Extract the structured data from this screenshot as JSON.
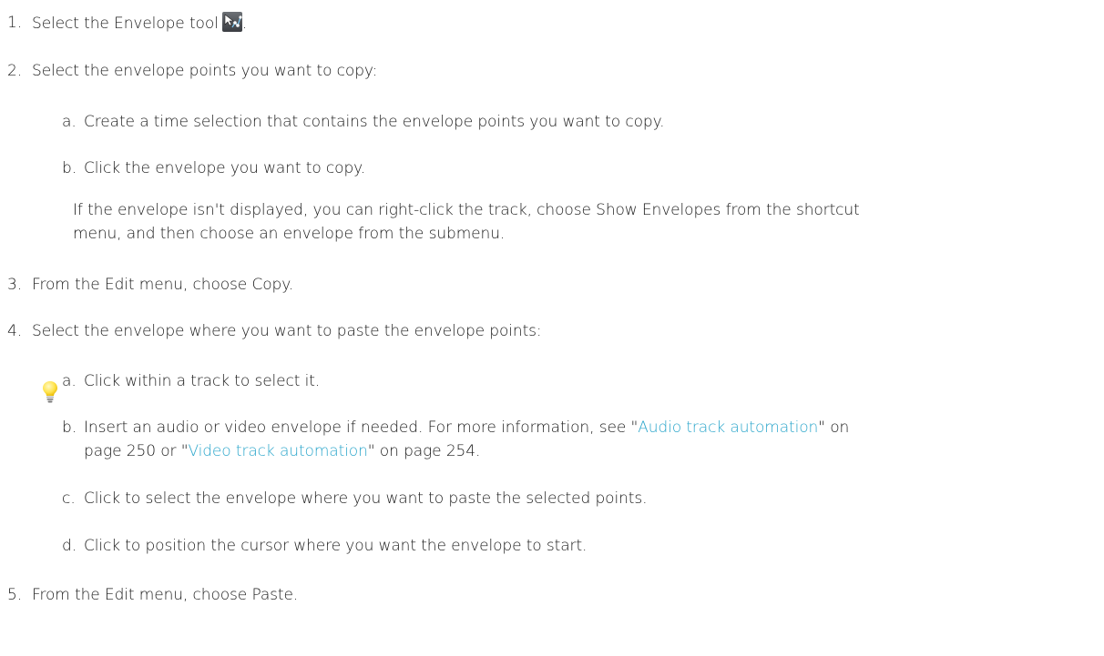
{
  "steps": {
    "s1": {
      "num": "1.",
      "text": "Select the Envelope tool",
      "after_icon": "."
    },
    "s2": {
      "num": "2.",
      "text": "Select the envelope points you want to copy:"
    },
    "s2a": {
      "num": "a.",
      "text": "Create a time selection that contains the envelope points you want to copy."
    },
    "s2b": {
      "num": "b.",
      "text": "Click the envelope you want to copy."
    },
    "tip": {
      "line1": "If the envelope isn't displayed, you can right-click the track, choose Show Envelopes from the shortcut",
      "line2": "menu, and then choose an envelope from the submenu."
    },
    "s3": {
      "num": "3.",
      "text": "From the Edit menu, choose Copy."
    },
    "s4": {
      "num": "4.",
      "text": "Select the envelope where you want to paste the envelope points:"
    },
    "s4a": {
      "num": "a.",
      "text": "Click within a track to select it."
    },
    "s4b": {
      "num": "b.",
      "part1": "Insert an audio or video envelope if needed. For more information, see \"",
      "link1": "Audio track automation",
      "part2": "\" on",
      "part3": "page 250 or \"",
      "link2": "Video track automation",
      "part4": "\" on page 254."
    },
    "s4c": {
      "num": "c.",
      "text": "Click to select the envelope where you want to paste the selected points."
    },
    "s4d": {
      "num": "d.",
      "text": "Click to position the cursor where you want the envelope to start."
    },
    "s5": {
      "num": "5.",
      "text": "From the Edit menu, choose Paste."
    }
  },
  "icons": {
    "envelope_tool": "envelope-tool-icon",
    "tip": "lightbulb-icon"
  },
  "colors": {
    "link": "#2ba6cb",
    "text": "#1a1a1a"
  }
}
